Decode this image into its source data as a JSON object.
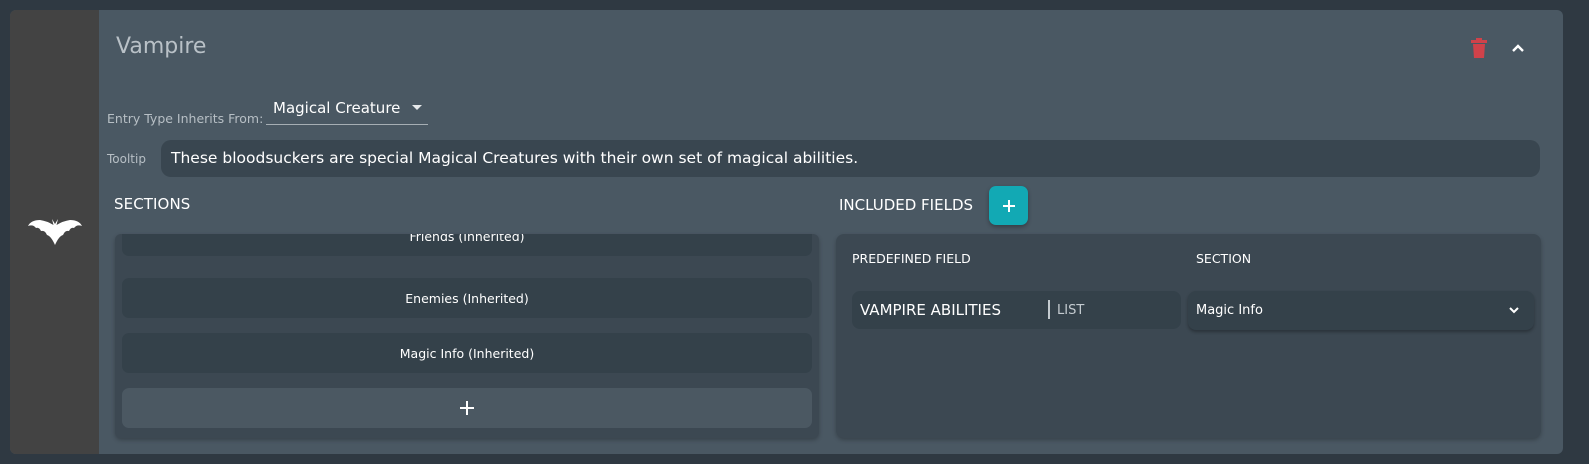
{
  "entry": {
    "title": "Vampire",
    "icon": "bat-icon"
  },
  "inherits": {
    "label": "Entry Type Inherits From:",
    "value": "Magical Creature"
  },
  "tooltip": {
    "label": "Tooltip",
    "value": "These bloodsuckers are special Magical Creatures with their own set of magical abilities."
  },
  "sections": {
    "heading": "SECTIONS",
    "items": [
      {
        "label": "Friends (Inherited)"
      },
      {
        "label": "Enemies (Inherited)"
      },
      {
        "label": "Magic Info (Inherited)"
      }
    ],
    "add_label": "+"
  },
  "included_fields": {
    "heading": "INCLUDED FIELDS",
    "add_label": "+",
    "columns": {
      "field": "PREDEFINED FIELD",
      "section": "SECTION"
    },
    "rows": [
      {
        "field": "VAMPIRE ABILITIES",
        "type": "LIST",
        "section": "Magic Info"
      }
    ]
  },
  "colors": {
    "accent": "#12a9b4",
    "danger": "#d0424a",
    "card": "#4a5863",
    "panel": "#3c4852"
  }
}
